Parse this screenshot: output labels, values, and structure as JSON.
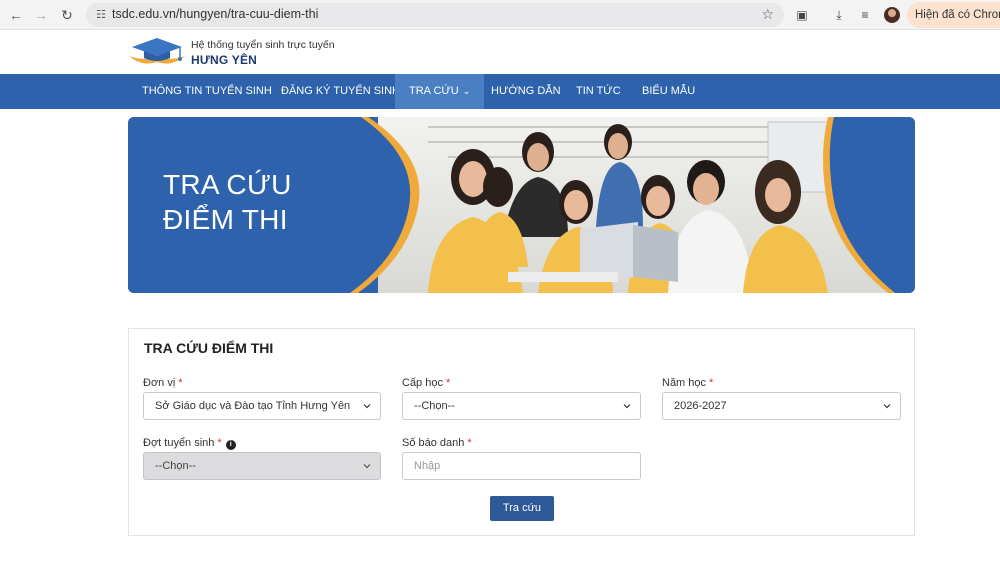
{
  "browser": {
    "url": "tsdc.edu.vn/hungyen/tra-cuu-diem-thi",
    "relaunch_label": "Hiện đã có Chrome"
  },
  "site": {
    "subtitle": "Hệ thống tuyển sinh trực tuyến",
    "name": "HƯNG YÊN"
  },
  "nav": {
    "items": [
      {
        "label": "THÔNG TIN TUYỂN SINH"
      },
      {
        "label": "ĐĂNG KÝ TUYỂN SINH"
      },
      {
        "label": "TRA CỨU"
      },
      {
        "label": "HƯỚNG DẪN"
      },
      {
        "label": "TIN TỨC"
      },
      {
        "label": "BIỂU MẪU"
      }
    ]
  },
  "banner": {
    "line1": "TRA CỨU",
    "line2": "ĐIỂM THI"
  },
  "form": {
    "title": "TRA CỨU ĐIỂM THI",
    "required_mark": "*",
    "unit": {
      "label": "Đơn vị",
      "value": "Sở Giáo dục và Đào tạo Tỉnh Hưng Yên"
    },
    "level": {
      "label": "Cấp học",
      "value": "--Chọn--"
    },
    "year": {
      "label": "Năm học",
      "value": "2026-2027"
    },
    "round": {
      "label": "Đợt tuyển sinh",
      "value": "--Chọn--"
    },
    "candidate_no": {
      "label": "Số báo danh",
      "placeholder": "Nhập"
    },
    "submit_label": "Tra cứu"
  },
  "colors": {
    "nav_bg": "#2e62ad",
    "nav_active": "#4b7fc4",
    "banner_accent": "#f0a93b",
    "button": "#2e5a99"
  }
}
